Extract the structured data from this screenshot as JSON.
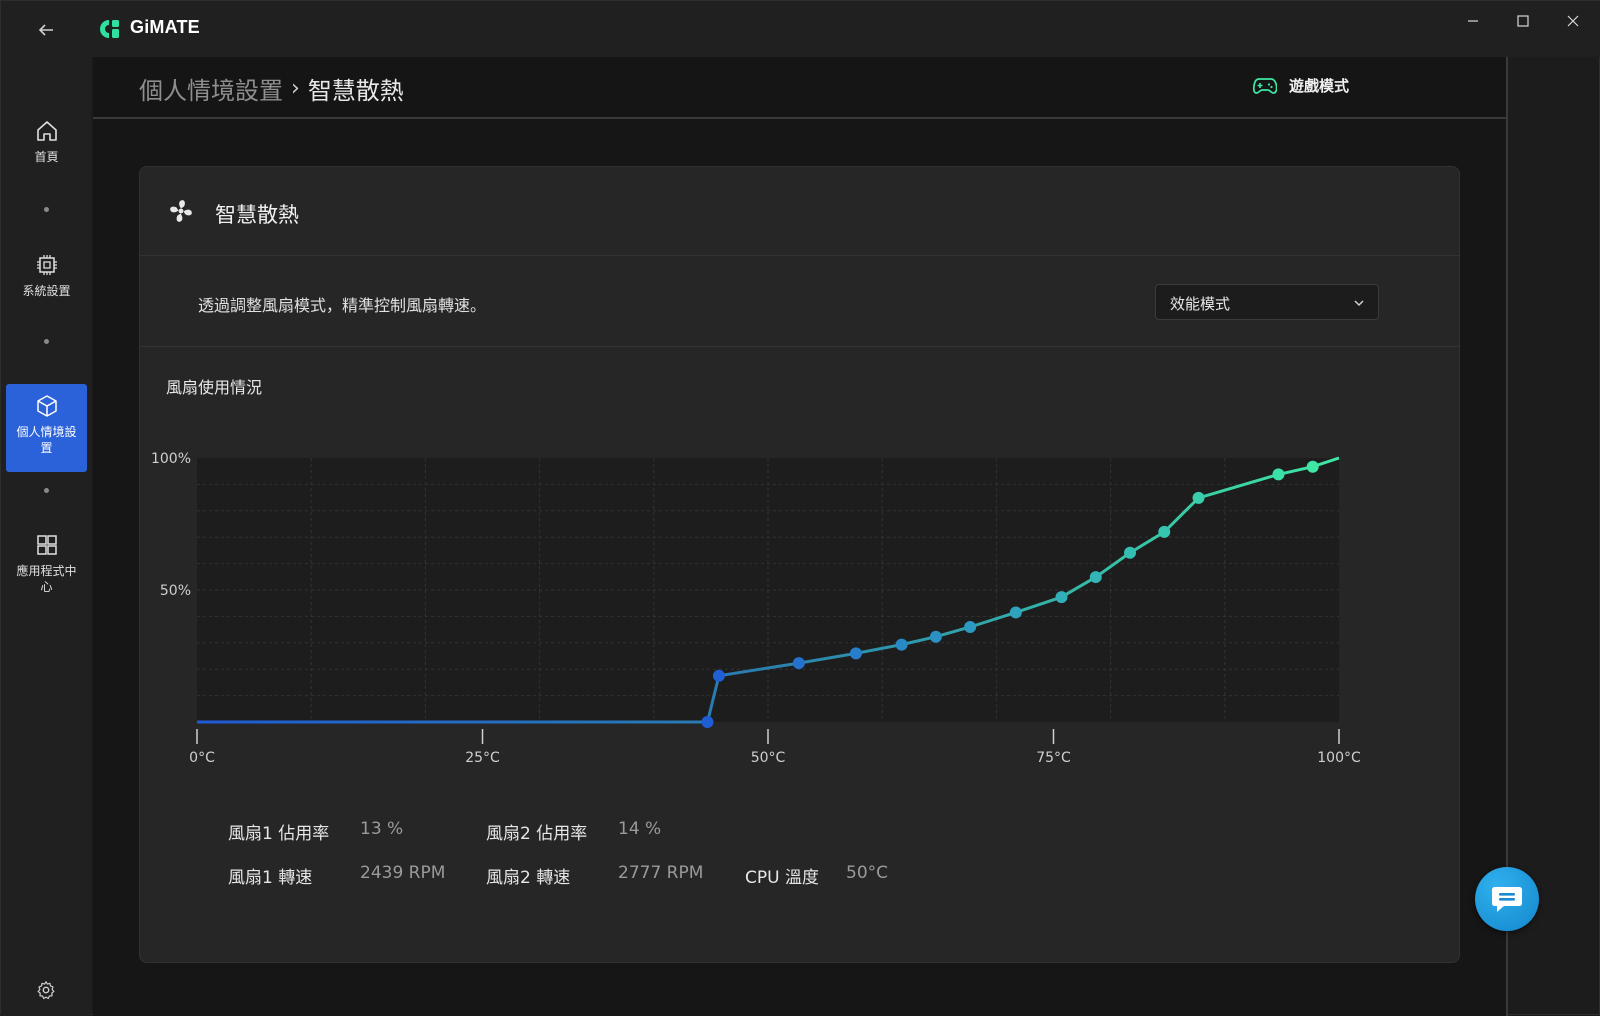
{
  "app": {
    "title": "GiMATE"
  },
  "sidebar": {
    "items": [
      {
        "label": "首頁",
        "icon": "home-icon"
      },
      {
        "label": "系統設置",
        "icon": "chip-icon"
      },
      {
        "label": "個人情境設置",
        "icon": "cube-icon",
        "active": true
      },
      {
        "label": "應用程式中心",
        "icon": "apps-grid-icon"
      }
    ]
  },
  "header": {
    "breadcrumb_parent": "個人情境設置",
    "breadcrumb_separator": "›",
    "breadcrumb_current": "智慧散熱",
    "game_mode_label": "遊戲模式"
  },
  "card": {
    "title": "智慧散熱",
    "description": "透過調整風扇模式，精準控制風扇轉速。",
    "mode_select": {
      "selected": "效能模式"
    },
    "usage_title": "風扇使用情況"
  },
  "chart_data": {
    "type": "line",
    "y_ticks": [
      "100%",
      "50%"
    ],
    "x_ticks": [
      "0°C",
      "25°C",
      "50°C",
      "75°C",
      "100°C"
    ],
    "xlim": [
      0,
      100
    ],
    "ylim": [
      0,
      100
    ],
    "grid": true,
    "series": [
      {
        "points": [
          [
            0,
            0
          ],
          [
            44.7,
            0
          ],
          [
            45.7,
            17.5
          ],
          [
            52.7,
            22.3
          ],
          [
            57.7,
            26
          ],
          [
            61.7,
            29.3
          ],
          [
            64.7,
            32.3
          ],
          [
            67.7,
            36
          ],
          [
            71.7,
            41.5
          ],
          [
            75.7,
            47.3
          ],
          [
            78.7,
            54.9
          ],
          [
            81.7,
            64.1
          ],
          [
            84.7,
            72
          ],
          [
            87.7,
            84.9
          ],
          [
            94.7,
            93.8
          ],
          [
            97.7,
            96.7
          ],
          [
            100,
            100
          ]
        ],
        "markers": [
          [
            44.7,
            0
          ],
          [
            45.7,
            17.5
          ],
          [
            52.7,
            22.3
          ],
          [
            57.7,
            26
          ],
          [
            61.7,
            29.3
          ],
          [
            64.7,
            32.3
          ],
          [
            67.7,
            36
          ],
          [
            71.7,
            41.5
          ],
          [
            75.7,
            47.3
          ],
          [
            78.7,
            54.9
          ],
          [
            81.7,
            64.1
          ],
          [
            84.7,
            72
          ],
          [
            87.7,
            84.9
          ],
          [
            94.7,
            93.8
          ],
          [
            97.7,
            96.7
          ]
        ]
      }
    ],
    "colors": {
      "start": "#1f5bd6",
      "end": "#3ee8a3"
    }
  },
  "stats": {
    "fan1_usage_label": "風扇1 佔用率",
    "fan1_usage_value": "13 %",
    "fan2_usage_label": "風扇2 佔用率",
    "fan2_usage_value": "14 %",
    "fan1_speed_label": "風扇1 轉速",
    "fan1_speed_value": "2439 RPM",
    "fan2_speed_label": "風扇2 轉速",
    "fan2_speed_value": "2777 RPM",
    "cpu_temp_label": "CPU 溫度",
    "cpu_temp_value": "50°C"
  }
}
